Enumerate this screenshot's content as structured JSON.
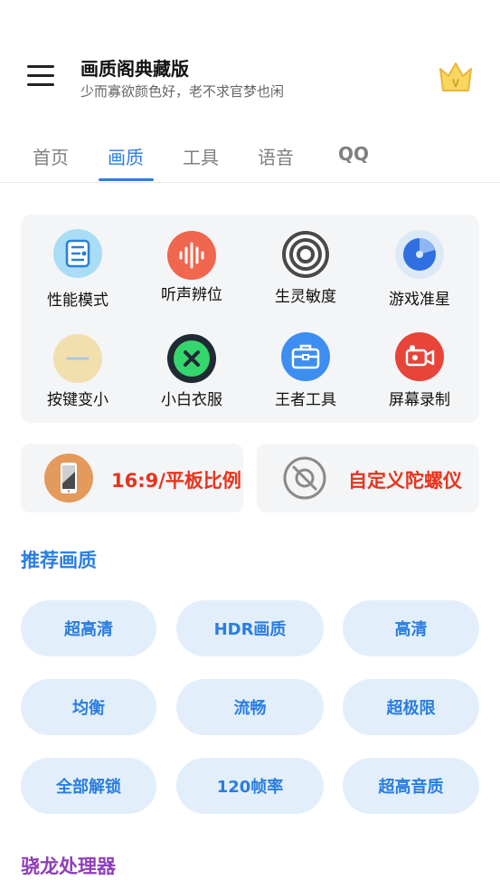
{
  "header": {
    "title": "画质阁典藏版",
    "subtitle": "少而寡欲颜色好，老不求官梦也闲",
    "menu_icon": "hamburger-menu-icon",
    "vip_icon": "crown-v-icon"
  },
  "tabs": [
    {
      "label": "首页",
      "active": false
    },
    {
      "label": "画质",
      "active": true
    },
    {
      "label": "工具",
      "active": false
    },
    {
      "label": "语音",
      "active": false
    },
    {
      "label": "QQ",
      "active": false
    }
  ],
  "tools": [
    {
      "label": "性能模式",
      "icon": "circuit-board-icon"
    },
    {
      "label": "听声辨位",
      "icon": "sound-wave-icon"
    },
    {
      "label": "生灵敏度",
      "icon": "target-rings-icon"
    },
    {
      "label": "游戏准星",
      "icon": "crosshair-pie-icon"
    },
    {
      "label": "按键变小",
      "icon": "minus-circle-icon"
    },
    {
      "label": "小白衣服",
      "icon": "close-circle-icon"
    },
    {
      "label": "王者工具",
      "icon": "toolbox-icon"
    },
    {
      "label": "屏幕录制",
      "icon": "video-camera-icon"
    }
  ],
  "features": [
    {
      "label": "16:9/平板比例",
      "icon": "tablet-phone-icon"
    },
    {
      "label": "自定义陀螺仪",
      "icon": "gyroscope-icon"
    }
  ],
  "recommend": {
    "title": "推荐画质",
    "options": [
      "超高清",
      "HDR画质",
      "高清",
      "均衡",
      "流畅",
      "超极限",
      "全部解锁",
      "120帧率",
      "超高音质"
    ]
  },
  "processor": {
    "title": "骁龙处理器"
  },
  "colors": {
    "accent": "#2a7de1",
    "feature_text": "#e8331c",
    "processor_title": "#8e3fb8",
    "pill_bg": "#e2effb"
  }
}
